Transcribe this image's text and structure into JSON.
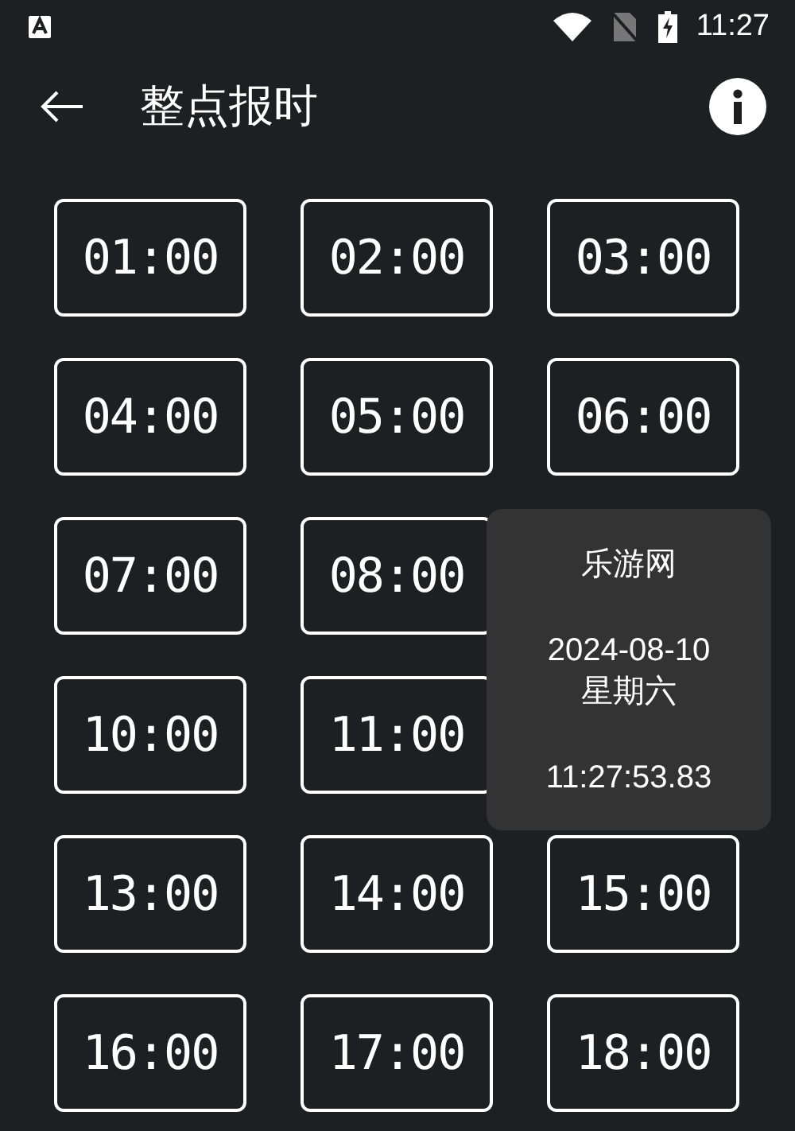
{
  "status_bar": {
    "time": "11:27"
  },
  "toolbar": {
    "title": "整点报时"
  },
  "rows": [
    {
      "buttons": [
        "01:00",
        "02:00",
        "03:00"
      ]
    },
    {
      "buttons": [
        "04:00",
        "05:00",
        "06:00"
      ]
    },
    {
      "buttons": [
        "07:00",
        "08:00"
      ]
    },
    {
      "buttons": [
        "10:00",
        "11:00"
      ]
    },
    {
      "buttons": [
        "13:00",
        "14:00",
        "15:00"
      ]
    },
    {
      "buttons": [
        "16:00",
        "17:00",
        "18:00"
      ]
    }
  ],
  "popup": {
    "title": "乐游网",
    "date": "2024-08-10",
    "weekday": "星期六",
    "time": "11:27:53.83"
  }
}
